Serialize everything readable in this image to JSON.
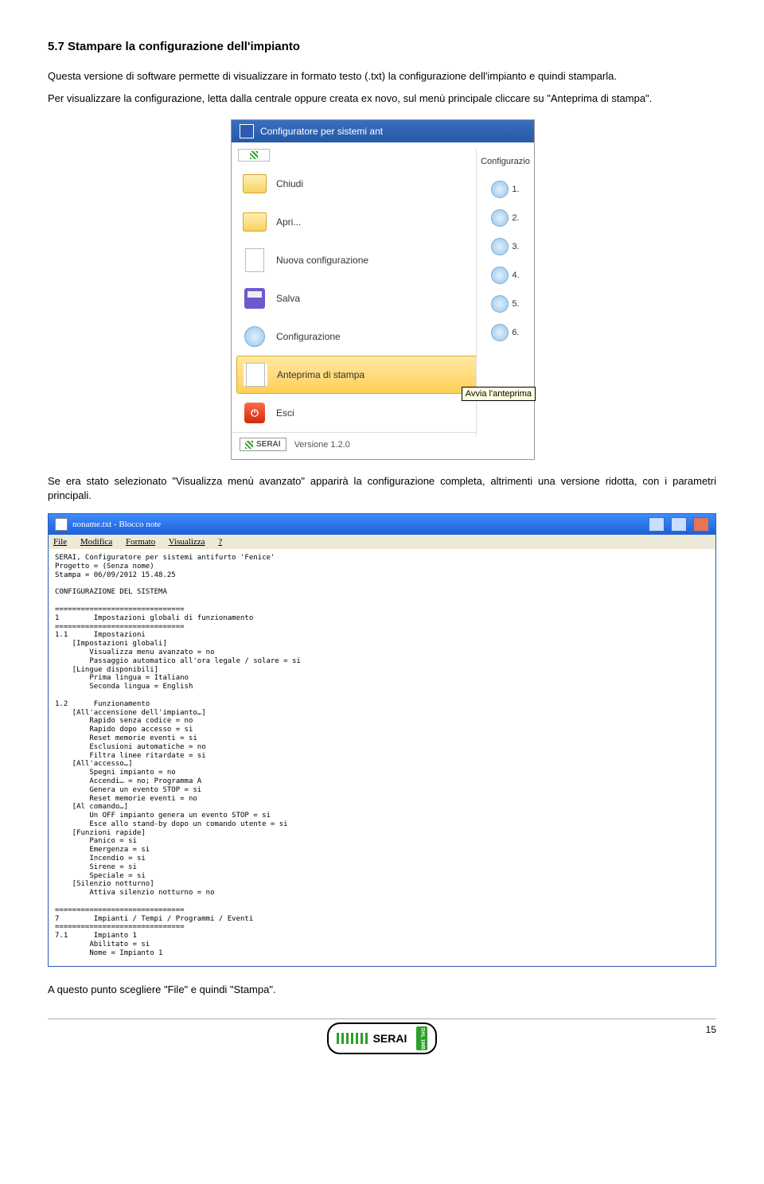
{
  "heading": "5.7   Stampare la configurazione dell'impianto",
  "para1": "Questa versione di software permette di visualizzare in formato testo (.txt) la configurazione dell'impianto e quindi stamparla.",
  "para2": "Per visualizzare la configurazione, letta dalla centrale oppure creata ex novo, sul menù principale cliccare su \"Anteprima di stampa\".",
  "para3": "Se era stato selezionato \"Visualizza menù avanzato\" apparirà la configurazione completa, altrimenti una versione ridotta, con i parametri principali.",
  "para4": "A questo punto scegliere \"File\" e quindi \"Stampa\".",
  "app": {
    "title": "Configuratore per sistemi ant",
    "menu": {
      "chiudi": "Chiudi",
      "apri": "Apri...",
      "nuova": "Nuova configurazione",
      "salva": "Salva",
      "config": "Configurazione",
      "anteprima": "Anteprima di stampa",
      "esci": "Esci"
    },
    "version_label": "Versione 1.2.0",
    "tooltip": "Avvia l'anteprima",
    "right_header": "Configurazio",
    "right_nums": [
      "1.",
      "2.",
      "3.",
      "4.",
      "5.",
      "6."
    ]
  },
  "notepad": {
    "title": "noname.txt - Blocco note",
    "menu": {
      "file": "File",
      "modifica": "Modifica",
      "formato": "Formato",
      "visualizza": "Visualizza",
      "help": "?"
    },
    "body": "SERAI, Configuratore per sistemi antifurto 'Fenice'\nProgetto = (Senza nome)\nStampa = 06/09/2012 15.48.25\n\nCONFIGURAZIONE DEL SISTEMA\n\n==============================\n1        Impostazioni globali di funzionamento\n==============================\n1.1      Impostazioni\n    [Impostazioni globali]\n        Visualizza menu avanzato = no\n        Passaggio automatico all'ora legale / solare = si\n    [Lingue disponibili]\n        Prima lingua = Italiano\n        Seconda lingua = English\n\n1.2      Funzionamento\n    [All'accensione dell'impianto…]\n        Rapido senza codice = no\n        Rapido dopo accesso = si\n        Reset memorie eventi = si\n        Esclusioni automatiche = no\n        Filtra linee ritardate = si\n    [All'accesso…]\n        Spegni impianto = no\n        Accendi… = no; Programma A\n        Genera un evento STOP = si\n        Reset memorie eventi = no\n    [Al comando…]\n        Un OFF impianto genera un evento STOP = si\n        Esce allo stand-by dopo un comando utente = si\n    [Funzioni rapide]\n        Panico = si\n        Emergenza = si\n        Incendio = si\n        Sirene = si\n        Speciale = si\n    [Silenzio notturno]\n        Attiva silenzio notturno = no\n\n==============================\n7        Impianti / Tempi / Programmi / Eventi\n==============================\n7.1      Impianto 1\n        Abilitato = si\n        Nome = Impianto 1"
  },
  "footer": {
    "brand": "SERAI",
    "since": "DAL 1965",
    "page": "15"
  }
}
